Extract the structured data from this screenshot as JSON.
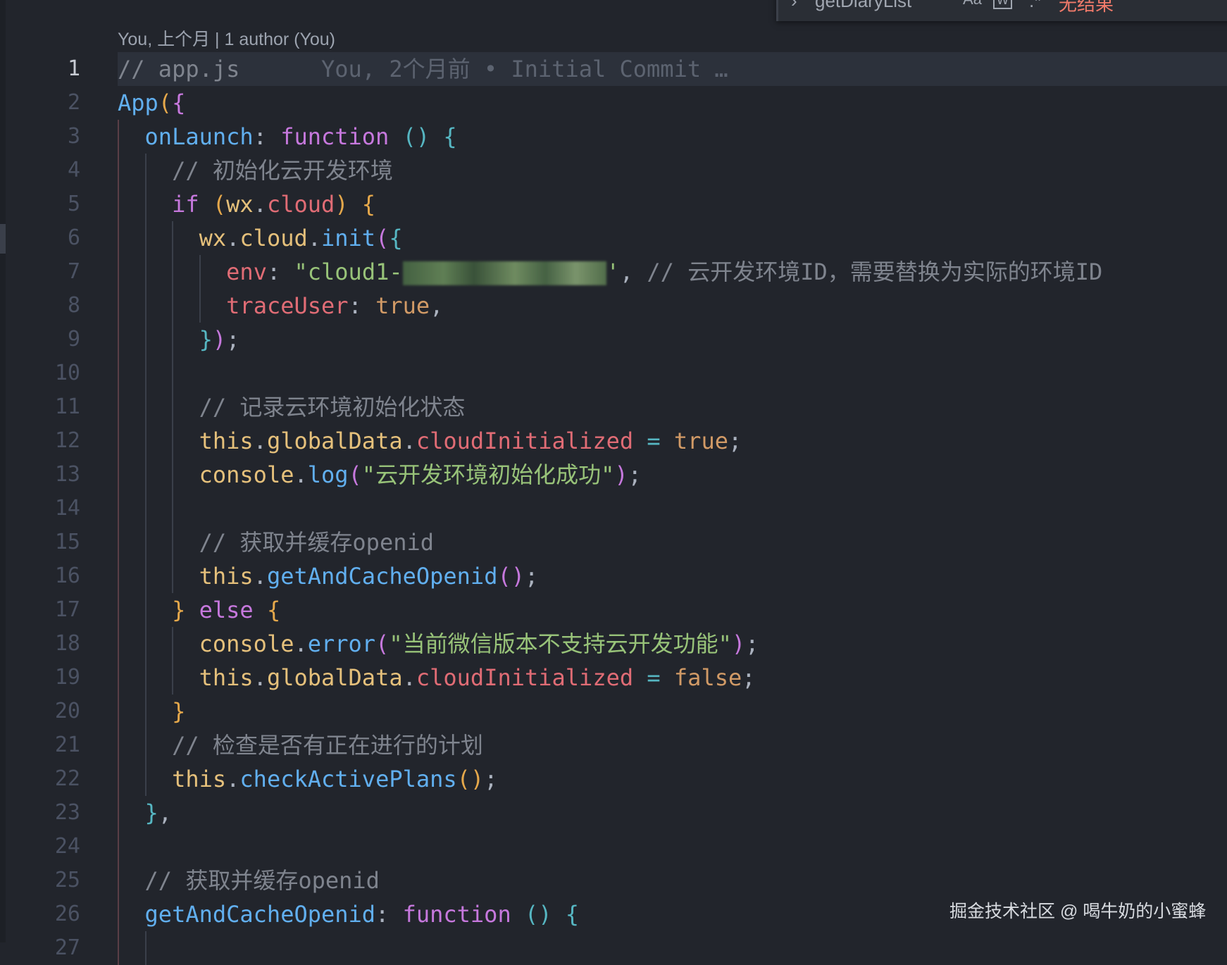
{
  "find_widget": {
    "chevron_icon": "chevron-right-icon",
    "query": "getDiaryList",
    "match_case_label": "Aa",
    "whole_word_label": "W",
    "regex_label": ".*",
    "result_text": "无结果",
    "result_color": "#f07a6a"
  },
  "blame_header": "You, 上个月 | 1 author (You)",
  "inline_blame": "You, 2个月前 • Initial Commit …",
  "current_line": 1,
  "colors": {
    "background": "#22252c",
    "keyword": "#c678dd",
    "function": "#61afef",
    "property": "#e06c75",
    "string": "#98c379",
    "boolean": "#d19a66",
    "comment": "#7f848e"
  },
  "lines": [
    {
      "n": "1",
      "indent": 0,
      "tokens": [
        [
          "// app.js",
          "c"
        ]
      ]
    },
    {
      "n": "2",
      "indent": 0,
      "tokens": [
        [
          "App",
          "f"
        ],
        [
          "(",
          "br1"
        ],
        [
          "{",
          "br2"
        ]
      ]
    },
    {
      "n": "3",
      "indent": 1,
      "tokens": [
        [
          "onLaunch",
          "f"
        ],
        [
          ": ",
          "w"
        ],
        [
          "function",
          "k"
        ],
        [
          " ",
          "w"
        ],
        [
          "()",
          "br3"
        ],
        [
          " ",
          "w"
        ],
        [
          "{",
          "br3"
        ]
      ]
    },
    {
      "n": "4",
      "indent": 2,
      "tokens": [
        [
          "// 初始化云开发环境",
          "c"
        ]
      ]
    },
    {
      "n": "5",
      "indent": 2,
      "tokens": [
        [
          "if",
          "k"
        ],
        [
          " ",
          "w"
        ],
        [
          "(",
          "br1"
        ],
        [
          "wx",
          "y"
        ],
        [
          ".",
          "w"
        ],
        [
          "cloud",
          "p"
        ],
        [
          ")",
          "br1"
        ],
        [
          " ",
          "w"
        ],
        [
          "{",
          "br1"
        ]
      ]
    },
    {
      "n": "6",
      "indent": 3,
      "tokens": [
        [
          "wx",
          "y"
        ],
        [
          ".",
          "w"
        ],
        [
          "cloud",
          "y"
        ],
        [
          ".",
          "w"
        ],
        [
          "init",
          "f"
        ],
        [
          "(",
          "br2"
        ],
        [
          "{",
          "br3"
        ]
      ]
    },
    {
      "n": "7",
      "indent": 4,
      "tokens": [
        [
          "env",
          "p"
        ],
        [
          ": ",
          "w"
        ],
        [
          "\"cloud1-",
          "s"
        ],
        [
          "",
          "blur"
        ],
        [
          "'",
          "s"
        ],
        [
          ", ",
          "w"
        ],
        [
          "// 云开发环境ID，需要替换为实际的环境ID",
          "c"
        ]
      ]
    },
    {
      "n": "8",
      "indent": 4,
      "tokens": [
        [
          "traceUser",
          "p"
        ],
        [
          ": ",
          "w"
        ],
        [
          "true",
          "b"
        ],
        [
          ",",
          "w"
        ]
      ]
    },
    {
      "n": "9",
      "indent": 3,
      "tokens": [
        [
          "}",
          "br3"
        ],
        [
          ")",
          "br2"
        ],
        [
          ";",
          "w"
        ]
      ]
    },
    {
      "n": "10",
      "indent": 3,
      "tokens": []
    },
    {
      "n": "11",
      "indent": 3,
      "tokens": [
        [
          "// 记录云环境初始化状态",
          "c"
        ]
      ]
    },
    {
      "n": "12",
      "indent": 3,
      "tokens": [
        [
          "this",
          "y"
        ],
        [
          ".",
          "w"
        ],
        [
          "globalData",
          "y"
        ],
        [
          ".",
          "w"
        ],
        [
          "cloudInitialized",
          "p"
        ],
        [
          " ",
          "w"
        ],
        [
          "=",
          "br3"
        ],
        [
          " ",
          "w"
        ],
        [
          "true",
          "b"
        ],
        [
          ";",
          "w"
        ]
      ]
    },
    {
      "n": "13",
      "indent": 3,
      "tokens": [
        [
          "console",
          "y"
        ],
        [
          ".",
          "w"
        ],
        [
          "log",
          "f"
        ],
        [
          "(",
          "br2"
        ],
        [
          "\"云开发环境初始化成功\"",
          "s"
        ],
        [
          ")",
          "br2"
        ],
        [
          ";",
          "w"
        ]
      ]
    },
    {
      "n": "14",
      "indent": 3,
      "tokens": []
    },
    {
      "n": "15",
      "indent": 3,
      "tokens": [
        [
          "// 获取并缓存openid",
          "c"
        ]
      ]
    },
    {
      "n": "16",
      "indent": 3,
      "tokens": [
        [
          "this",
          "y"
        ],
        [
          ".",
          "w"
        ],
        [
          "getAndCacheOpenid",
          "f"
        ],
        [
          "()",
          "br2"
        ],
        [
          ";",
          "w"
        ]
      ]
    },
    {
      "n": "17",
      "indent": 2,
      "tokens": [
        [
          "}",
          "br1"
        ],
        [
          " ",
          "w"
        ],
        [
          "else",
          "k"
        ],
        [
          " ",
          "w"
        ],
        [
          "{",
          "br1"
        ]
      ]
    },
    {
      "n": "18",
      "indent": 3,
      "tokens": [
        [
          "console",
          "y"
        ],
        [
          ".",
          "w"
        ],
        [
          "error",
          "f"
        ],
        [
          "(",
          "br2"
        ],
        [
          "\"当前微信版本不支持云开发功能\"",
          "s"
        ],
        [
          ")",
          "br2"
        ],
        [
          ";",
          "w"
        ]
      ]
    },
    {
      "n": "19",
      "indent": 3,
      "tokens": [
        [
          "this",
          "y"
        ],
        [
          ".",
          "w"
        ],
        [
          "globalData",
          "y"
        ],
        [
          ".",
          "w"
        ],
        [
          "cloudInitialized",
          "p"
        ],
        [
          " ",
          "w"
        ],
        [
          "=",
          "br3"
        ],
        [
          " ",
          "w"
        ],
        [
          "false",
          "b"
        ],
        [
          ";",
          "w"
        ]
      ]
    },
    {
      "n": "20",
      "indent": 2,
      "tokens": [
        [
          "}",
          "br1"
        ]
      ]
    },
    {
      "n": "21",
      "indent": 2,
      "tokens": [
        [
          "// 检查是否有正在进行的计划",
          "c"
        ]
      ]
    },
    {
      "n": "22",
      "indent": 2,
      "tokens": [
        [
          "this",
          "y"
        ],
        [
          ".",
          "w"
        ],
        [
          "checkActivePlans",
          "f"
        ],
        [
          "()",
          "br1"
        ],
        [
          ";",
          "w"
        ]
      ]
    },
    {
      "n": "23",
      "indent": 1,
      "tokens": [
        [
          "}",
          "br3"
        ],
        [
          ",",
          "w"
        ]
      ]
    },
    {
      "n": "24",
      "indent": 1,
      "tokens": []
    },
    {
      "n": "25",
      "indent": 1,
      "tokens": [
        [
          "// 获取并缓存openid",
          "c"
        ]
      ]
    },
    {
      "n": "26",
      "indent": 1,
      "tokens": [
        [
          "getAndCacheOpenid",
          "f"
        ],
        [
          ": ",
          "w"
        ],
        [
          "function",
          "k"
        ],
        [
          " ",
          "w"
        ],
        [
          "()",
          "br3"
        ],
        [
          " ",
          "w"
        ],
        [
          "{",
          "br3"
        ]
      ]
    },
    {
      "n": "27",
      "indent": 2,
      "tokens": []
    }
  ],
  "watermark": "掘金技术社区 @ 喝牛奶的小蜜蜂"
}
